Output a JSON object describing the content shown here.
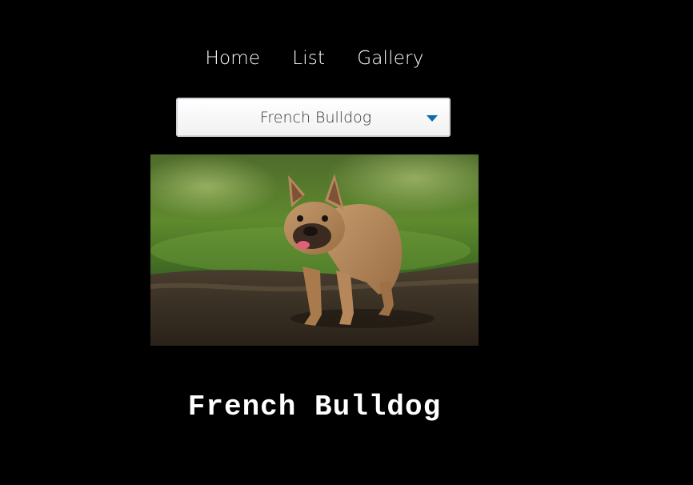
{
  "nav": {
    "items": [
      {
        "label": "Home"
      },
      {
        "label": "List"
      },
      {
        "label": "Gallery"
      }
    ]
  },
  "breed_select": {
    "selected": "French Bulldog",
    "caret_color": "#0b6ea8"
  },
  "image": {
    "subject": "french-bulldog-photo"
  },
  "breed": {
    "title": "French Bulldog"
  },
  "colors": {
    "background": "#000000",
    "text": "#ffffff"
  }
}
